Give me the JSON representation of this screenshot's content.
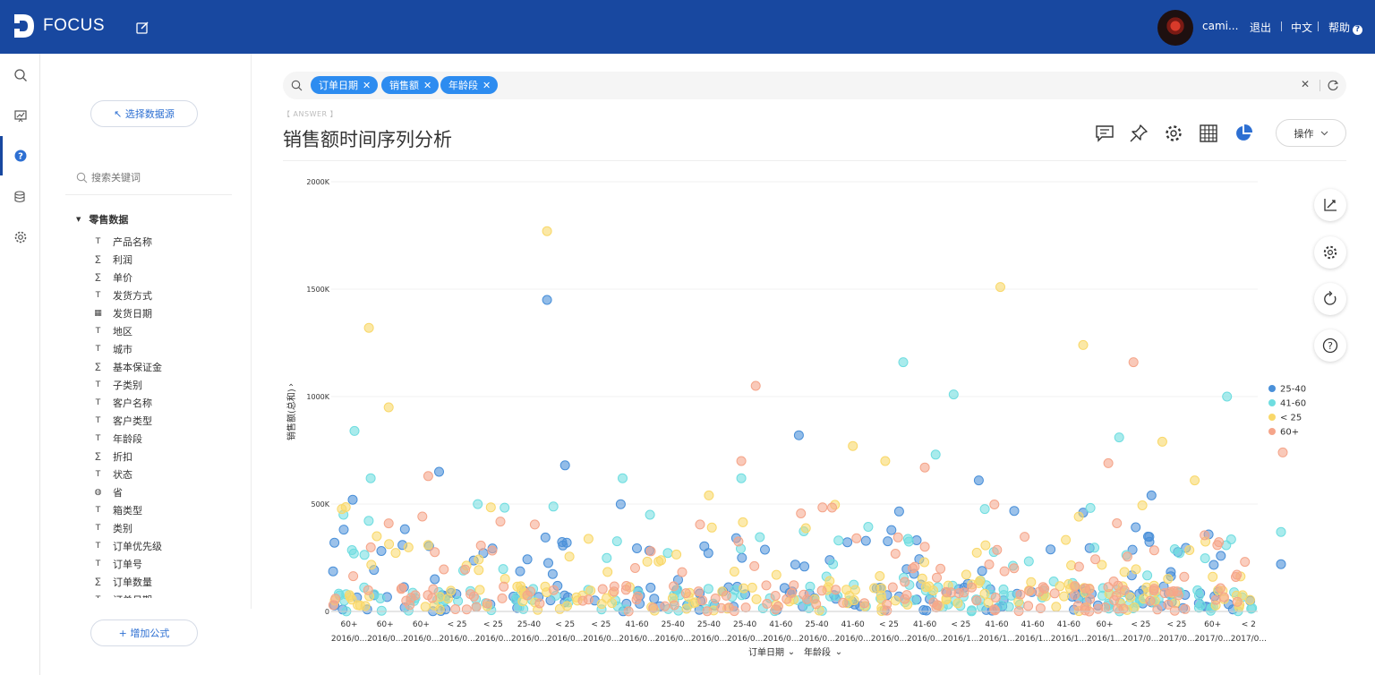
{
  "app": {
    "logo_text": "FOCUS",
    "user_name": "cami...",
    "logout": "退出",
    "language": "中文",
    "help": "帮助"
  },
  "rail": {
    "items": [
      {
        "name": "search-icon"
      },
      {
        "name": "board-icon"
      },
      {
        "name": "question-icon",
        "active": true
      },
      {
        "name": "database-icon"
      },
      {
        "name": "gear-icon"
      }
    ]
  },
  "panel": {
    "select_source_label": "↖ 选择数据源",
    "search_placeholder": "搜索关键词",
    "root_label": "零售数据",
    "fields": [
      {
        "label": "产品名称",
        "type": "text"
      },
      {
        "label": "利润",
        "type": "measure"
      },
      {
        "label": "单价",
        "type": "measure"
      },
      {
        "label": "发货方式",
        "type": "text"
      },
      {
        "label": "发货日期",
        "type": "date"
      },
      {
        "label": "地区",
        "type": "text"
      },
      {
        "label": "城市",
        "type": "text"
      },
      {
        "label": "基本保证金",
        "type": "measure"
      },
      {
        "label": "子类别",
        "type": "text"
      },
      {
        "label": "客户名称",
        "type": "text"
      },
      {
        "label": "客户类型",
        "type": "text"
      },
      {
        "label": "年龄段",
        "type": "text"
      },
      {
        "label": "折扣",
        "type": "measure"
      },
      {
        "label": "状态",
        "type": "text"
      },
      {
        "label": "省",
        "type": "geo"
      },
      {
        "label": "箱类型",
        "type": "text"
      },
      {
        "label": "类别",
        "type": "text"
      },
      {
        "label": "订单优先级",
        "type": "text"
      },
      {
        "label": "订单号",
        "type": "text"
      },
      {
        "label": "订单数量",
        "type": "measure"
      },
      {
        "label": "订单日期",
        "type": "text"
      }
    ],
    "add_formula_label": "+ 增加公式"
  },
  "search": {
    "chips": [
      "订单日期",
      "销售额",
      "年龄段"
    ]
  },
  "answer": {
    "tag": "【 ANSWER 】",
    "title": "销售额时间序列分析",
    "ops_label": "操作"
  },
  "colors": {
    "topbar": "#1848a0",
    "accent": "#2d8cf0",
    "series_25_40": "#4a90d9",
    "series_41_60": "#6fdde0",
    "series_lt25": "#f9d86a",
    "series_60plus": "#f5a58a"
  },
  "chart_data": {
    "type": "scatter",
    "ylabel": "销售额(总和)",
    "ylim": [
      0,
      2000000
    ],
    "y_ticks": [
      "0",
      "500K",
      "1000K",
      "1500K",
      "2000K"
    ],
    "x_axis_labels": [
      "订单日期",
      "年龄段"
    ],
    "x_ticks": [
      [
        "60+",
        "2016/0..."
      ],
      [
        "60+",
        "2016/0..."
      ],
      [
        "60+",
        "2016/0..."
      ],
      [
        "< 25",
        "2016/0..."
      ],
      [
        "< 25",
        "2016/0..."
      ],
      [
        "25-40",
        "2016/0..."
      ],
      [
        "< 25",
        "2016/0..."
      ],
      [
        "< 25",
        "2016/0..."
      ],
      [
        "41-60",
        "2016/0..."
      ],
      [
        "25-40",
        "2016/0..."
      ],
      [
        "25-40",
        "2016/0..."
      ],
      [
        "25-40",
        "2016/0..."
      ],
      [
        "41-60",
        "2016/0..."
      ],
      [
        "25-40",
        "2016/0..."
      ],
      [
        "41-60",
        "2016/0..."
      ],
      [
        "< 25",
        "2016/0..."
      ],
      [
        "41-60",
        "2016/0..."
      ],
      [
        "< 25",
        "2016/1..."
      ],
      [
        "41-60",
        "2016/1..."
      ],
      [
        "41-60",
        "2016/1..."
      ],
      [
        "41-60",
        "2016/1..."
      ],
      [
        "60+",
        "2016/1..."
      ],
      [
        "< 25",
        "2017/0..."
      ],
      [
        "< 25",
        "2017/0..."
      ],
      [
        "60+",
        "2017/0..."
      ],
      [
        "< 2",
        "2017/0..."
      ]
    ],
    "series": [
      {
        "name": "25-40",
        "color": "#4a90d9",
        "highlights": [
          [
            0.1,
            520000
          ],
          [
            5.5,
            1450000
          ],
          [
            2.5,
            650000
          ],
          [
            6.0,
            680000
          ],
          [
            12.5,
            820000
          ],
          [
            17.5,
            610000
          ],
          [
            20.4,
            460000
          ],
          [
            22.3,
            540000
          ],
          [
            25.9,
            220000
          ]
        ]
      },
      {
        "name": "41-60",
        "color": "#6fdde0",
        "highlights": [
          [
            0.15,
            840000
          ],
          [
            0.6,
            620000
          ],
          [
            7.6,
            620000
          ],
          [
            15.4,
            1160000
          ],
          [
            16.8,
            1010000
          ],
          [
            16.3,
            730000
          ],
          [
            21.4,
            810000
          ],
          [
            24.4,
            1000000
          ],
          [
            10.9,
            620000
          ],
          [
            25.9,
            370000
          ]
        ]
      },
      {
        "name": "< 25",
        "color": "#f9d86a",
        "highlights": [
          [
            0.55,
            1320000
          ],
          [
            1.1,
            950000
          ],
          [
            5.5,
            1770000
          ],
          [
            18.1,
            1510000
          ],
          [
            20.4,
            1240000
          ],
          [
            22.6,
            790000
          ],
          [
            10.0,
            540000
          ],
          [
            14.0,
            770000
          ],
          [
            23.5,
            610000
          ],
          [
            14.9,
            700000
          ]
        ]
      },
      {
        "name": "60+",
        "color": "#f5a58a",
        "highlights": [
          [
            2.2,
            630000
          ],
          [
            11.3,
            1050000
          ],
          [
            21.8,
            1160000
          ],
          [
            10.9,
            700000
          ],
          [
            16.0,
            670000
          ],
          [
            21.1,
            690000
          ],
          [
            25.95,
            740000
          ],
          [
            1.1,
            410000
          ]
        ]
      }
    ],
    "legend_position": "right",
    "grid": true
  }
}
